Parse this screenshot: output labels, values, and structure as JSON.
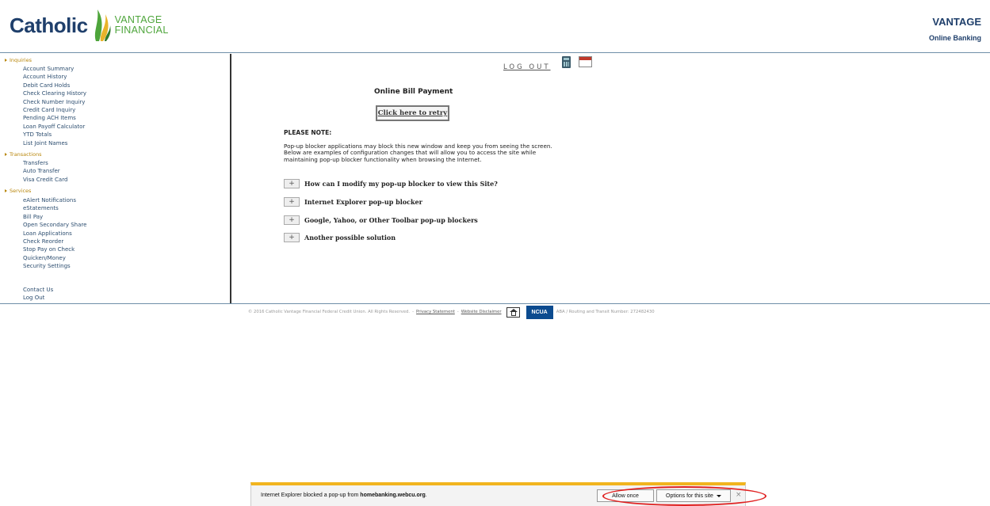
{
  "header": {
    "logo_word": "Catholic",
    "logo_line1": "VANTAGE",
    "logo_line2": "FINANCIAL",
    "brand_title": "VANTAGE",
    "brand_subtitle": "Online Banking"
  },
  "sidebar": {
    "sections": [
      {
        "title": "Inquiries",
        "items": [
          "Account Summary",
          "Account History",
          "Debit Card Holds",
          "Check Clearing History",
          "Check Number Inquiry",
          "Credit Card Inquiry",
          "Pending ACH Items",
          "Loan Payoff Calculator",
          "YTD Totals",
          "List Joint Names"
        ]
      },
      {
        "title": "Transactions",
        "items": [
          "Transfers",
          "Auto Transfer",
          "Visa Credit Card"
        ]
      },
      {
        "title": "Services",
        "items": [
          "eAlert Notifications",
          "eStatements",
          "Bill Pay",
          "Open Secondary Share",
          "Loan Applications",
          "Check Reorder",
          "Stop Pay on Check",
          "Quicken/Money",
          "Security Settings"
        ]
      }
    ],
    "footer_items": [
      "Contact Us",
      "Log Out"
    ]
  },
  "main": {
    "logout_label": "LOG OUT",
    "title": "Online Bill Payment",
    "retry_label": "Click here to retry",
    "note_title": "PLEASE NOTE:",
    "note_body": "Pop-up blocker applications may block this new window and keep you from seeing the screen. Below are examples of configuration changes that will allow you to access the site while maintaining pop-up blocker functionality when browsing the Internet.",
    "faq": [
      "How can I modify my pop-up blocker to view this Site?",
      "Internet Explorer pop-up blocker",
      "Google, Yahoo, or Other Toolbar pop-up blockers",
      "Another possible solution"
    ],
    "faq_toggle": "+"
  },
  "footer": {
    "copyright": "© 2016 Catholic Vantage Financial Federal Credit Union. All Rights Reserved.",
    "privacy_label": "Privacy Statement",
    "disclaimer_label": "Website Disclaimer",
    "ncua_label": "NCUA",
    "aba_text": "ABA / Routing and Transit Number: 272482430"
  },
  "ie_bar": {
    "message_prefix": "Internet Explorer blocked a pop-up from ",
    "message_domain": "homebanking.webcu.org",
    "message_suffix": ".",
    "allow_label": "Allow once",
    "options_label": "Options for this site",
    "close_label": "×"
  },
  "colors": {
    "brand_navy": "#1f3f6b",
    "brand_green": "#4ea53b",
    "section_gold": "#b8860b",
    "ie_bar_accent": "#f1b41e",
    "highlight_red": "#e02020",
    "ncua_blue": "#0c4b8f"
  },
  "icons": [
    "calculator-icon",
    "calendar-icon",
    "equal-housing-icon",
    "flame-logo-icon",
    "close-icon",
    "chevron-down-icon"
  ]
}
